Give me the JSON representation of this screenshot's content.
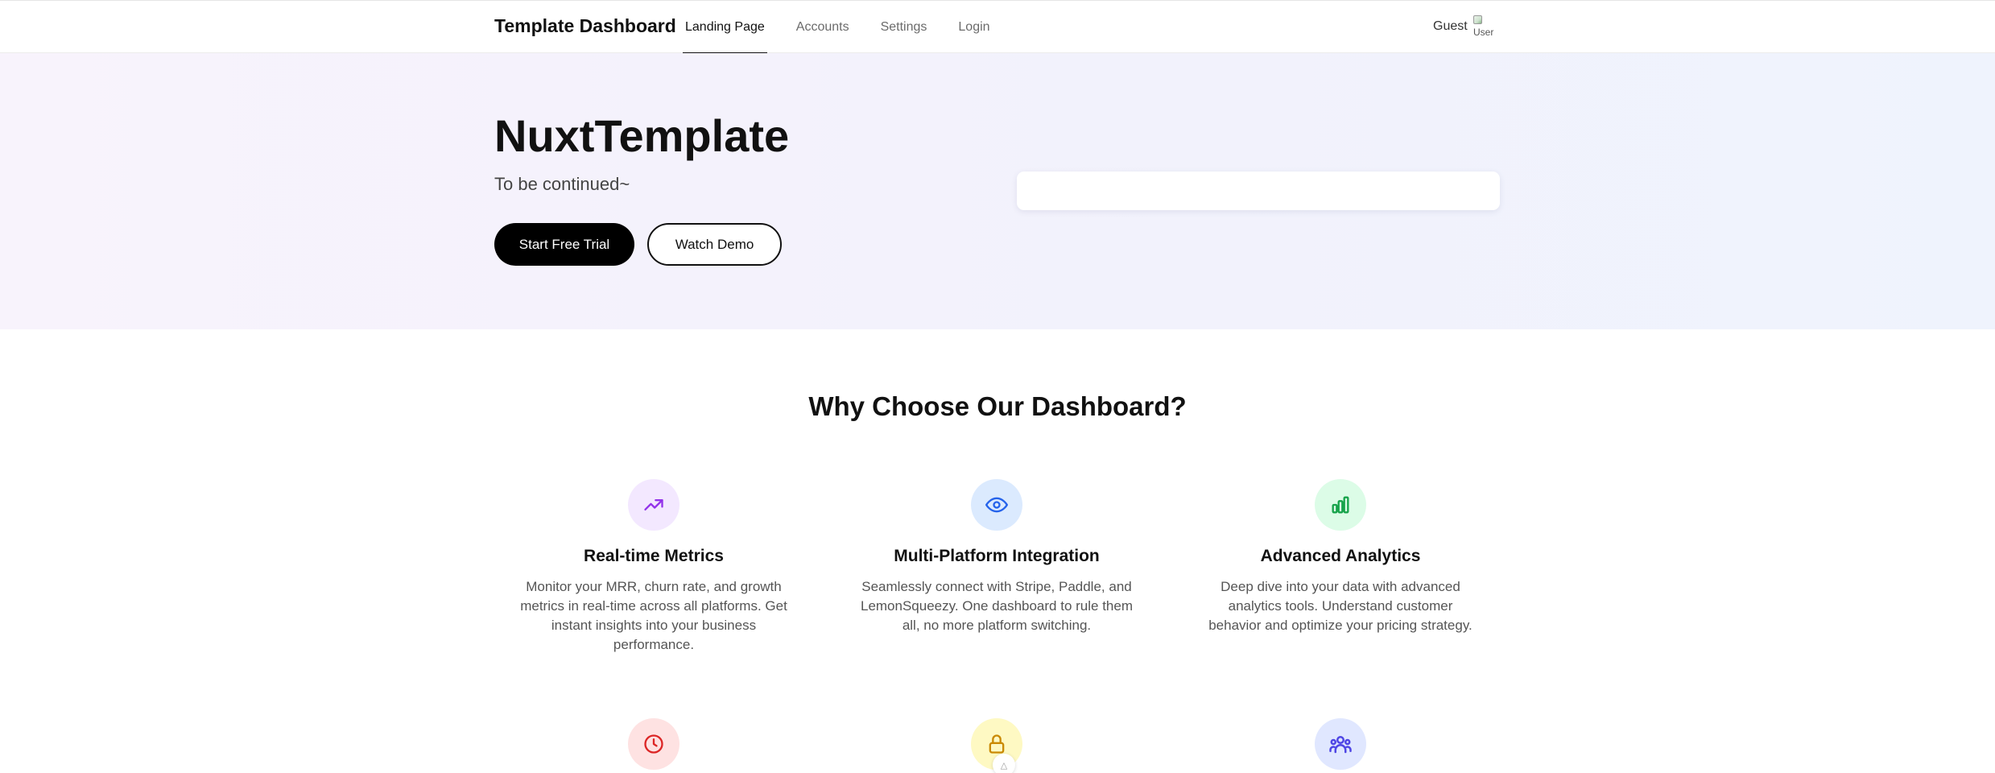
{
  "header": {
    "brand": "Template Dashboard",
    "nav": [
      {
        "label": "Landing Page",
        "active": true
      },
      {
        "label": "Accounts",
        "active": false
      },
      {
        "label": "Settings",
        "active": false
      },
      {
        "label": "Login",
        "active": false
      }
    ],
    "user_label": "Guest",
    "avatar_alt": "User"
  },
  "hero": {
    "title": "NuxtTemplate",
    "subtitle": "To be continued~",
    "primary_button": "Start Free Trial",
    "secondary_button": "Watch Demo"
  },
  "features": {
    "title": "Why Choose Our Dashboard?",
    "items": [
      {
        "title": "Real-time Metrics",
        "description": "Monitor your MRR, churn rate, and growth metrics in real-time across all platforms. Get instant insights into your business performance.",
        "icon": "trending-up-icon",
        "icon_color": "#9333ea",
        "bg_color": "#f3e8ff"
      },
      {
        "title": "Multi-Platform Integration",
        "description": "Seamlessly connect with Stripe, Paddle, and LemonSqueezy. One dashboard to rule them all, no more platform switching.",
        "icon": "eye-icon",
        "icon_color": "#2563eb",
        "bg_color": "#dbeafe"
      },
      {
        "title": "Advanced Analytics",
        "description": "Deep dive into your data with advanced analytics tools. Understand customer behavior and optimize your pricing strategy.",
        "icon": "bar-chart-icon",
        "icon_color": "#16a34a",
        "bg_color": "#dcfce7"
      },
      {
        "title": "",
        "description": "",
        "icon": "clock-icon",
        "icon_color": "#dc2626",
        "bg_color": "#fee2e2"
      },
      {
        "title": "",
        "description": "",
        "icon": "lock-icon",
        "icon_color": "#ca8a04",
        "bg_color": "#fef9c3"
      },
      {
        "title": "",
        "description": "",
        "icon": "users-icon",
        "icon_color": "#4f46e5",
        "bg_color": "#e0e7ff"
      }
    ]
  }
}
